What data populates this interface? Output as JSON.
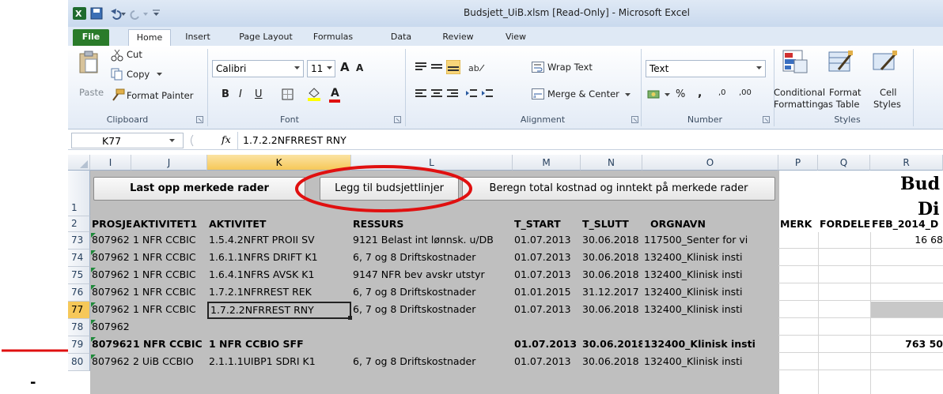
{
  "window": {
    "title": "Budsjett_UiB.xlsm  [Read-Only]  -  Microsoft Excel"
  },
  "tabs": [
    "File",
    "Home",
    "Insert",
    "Page Layout",
    "Formulas",
    "Data",
    "Review",
    "View"
  ],
  "ribbon": {
    "clipboard": {
      "paste": "Paste",
      "cut": "Cut",
      "copy": "Copy",
      "format_painter": "Format Painter",
      "label": "Clipboard"
    },
    "font": {
      "name": "Calibri",
      "size": "11",
      "bold": "B",
      "italic": "I",
      "underline": "U",
      "grow": "A",
      "shrink": "A",
      "color": "A",
      "label": "Font"
    },
    "alignment": {
      "wrap": "Wrap Text",
      "merge": "Merge & Center",
      "label": "Alignment"
    },
    "number": {
      "format": "Text",
      "percent": "%",
      "comma": ",",
      "inc": ",0",
      "dec": ",00",
      "label": "Number"
    },
    "styles": {
      "conditional1": "Conditional",
      "conditional2": "Formatting",
      "table1": "Format",
      "table2": "as Table",
      "cell1": "Cell",
      "cell2": "Styles",
      "label": "Styles"
    }
  },
  "formula_bar": {
    "name_box": "K77",
    "fx": "fx",
    "content": "1.7.2.2NFRREST RNY"
  },
  "columns": [
    "I",
    "J",
    "K",
    "L",
    "M",
    "N",
    "O",
    "P",
    "Q",
    "R"
  ],
  "buttons": {
    "upload": "Last opp merkede rader",
    "add_lines": "Legg til budsjettlinjer",
    "calc": "Beregn total kostnad og inntekt på merkede rader"
  },
  "right_title": {
    "line1": "Bud",
    "line2": "Di"
  },
  "header_row": {
    "num": "2",
    "cells": [
      "PROSJE",
      "AKTIVITET1",
      "AKTIVITET",
      "RESSURS",
      "T_START",
      "T_SLUTT",
      "ORGNAVN",
      "MERK",
      "FORDELE",
      "FEB_2014_D"
    ]
  },
  "rows": [
    {
      "num": "1",
      "cells": []
    },
    {
      "num": "73",
      "cells": [
        "807962",
        "1 NFR CCBIC",
        "1.5.4.2NFRT PROII SV",
        "9121 Belast int lønnsk. u/DB",
        "01.07.2013",
        "30.06.2018",
        "117500_Senter for vi",
        "",
        "",
        "16 68"
      ]
    },
    {
      "num": "74",
      "cells": [
        "807962",
        "1 NFR CCBIC",
        "1.6.1.1NFRS DRIFT K1",
        "6, 7 og 8 Driftskostnader",
        "01.07.2013",
        "30.06.2018",
        "132400_Klinisk insti",
        "",
        "",
        ""
      ]
    },
    {
      "num": "75",
      "cells": [
        "807962",
        "1 NFR CCBIC",
        "1.6.4.1NFRS AVSK K1",
        "9147 NFR bev avskr utstyr",
        "01.07.2013",
        "30.06.2018",
        "132400_Klinisk insti",
        "",
        "",
        ""
      ]
    },
    {
      "num": "76",
      "cells": [
        "807962",
        "1 NFR CCBIC",
        "1.7.2.1NFRREST REK",
        "6, 7 og 8 Driftskostnader",
        "01.01.2015",
        "31.12.2017",
        "132400_Klinisk insti",
        "",
        "",
        ""
      ]
    },
    {
      "num": "77",
      "cells": [
        "807962",
        "1 NFR CCBIC",
        "1.7.2.2NFRREST RNY",
        "6, 7 og 8 Driftskostnader",
        "01.07.2013",
        "30.06.2018",
        "132400_Klinisk insti",
        "",
        "",
        ""
      ]
    },
    {
      "num": "78",
      "cells": [
        "807962",
        "",
        "",
        "",
        "",
        "",
        "",
        "",
        "",
        ""
      ]
    },
    {
      "num": "79",
      "cells": [
        "807962",
        "1 NFR CCBIC",
        "1 NFR CCBIO SFF",
        "",
        "01.07.2013",
        "30.06.2018",
        "132400_Klinisk insti",
        "",
        "",
        "763 50"
      ]
    },
    {
      "num": "80",
      "cells": [
        "807962",
        "2 UiB CCBIO",
        "2.1.1.1UIBP1 SDRI K1",
        "6, 7 og 8 Driftskostnader",
        "01.07.2013",
        "30.06.2018",
        "132400_Klinisk insti",
        "",
        "",
        ""
      ]
    }
  ],
  "dash": "-",
  "colors": {
    "annotation_red": "#e01010",
    "selected_header": "#f6c859",
    "excel_green": "#2a7b2a"
  }
}
